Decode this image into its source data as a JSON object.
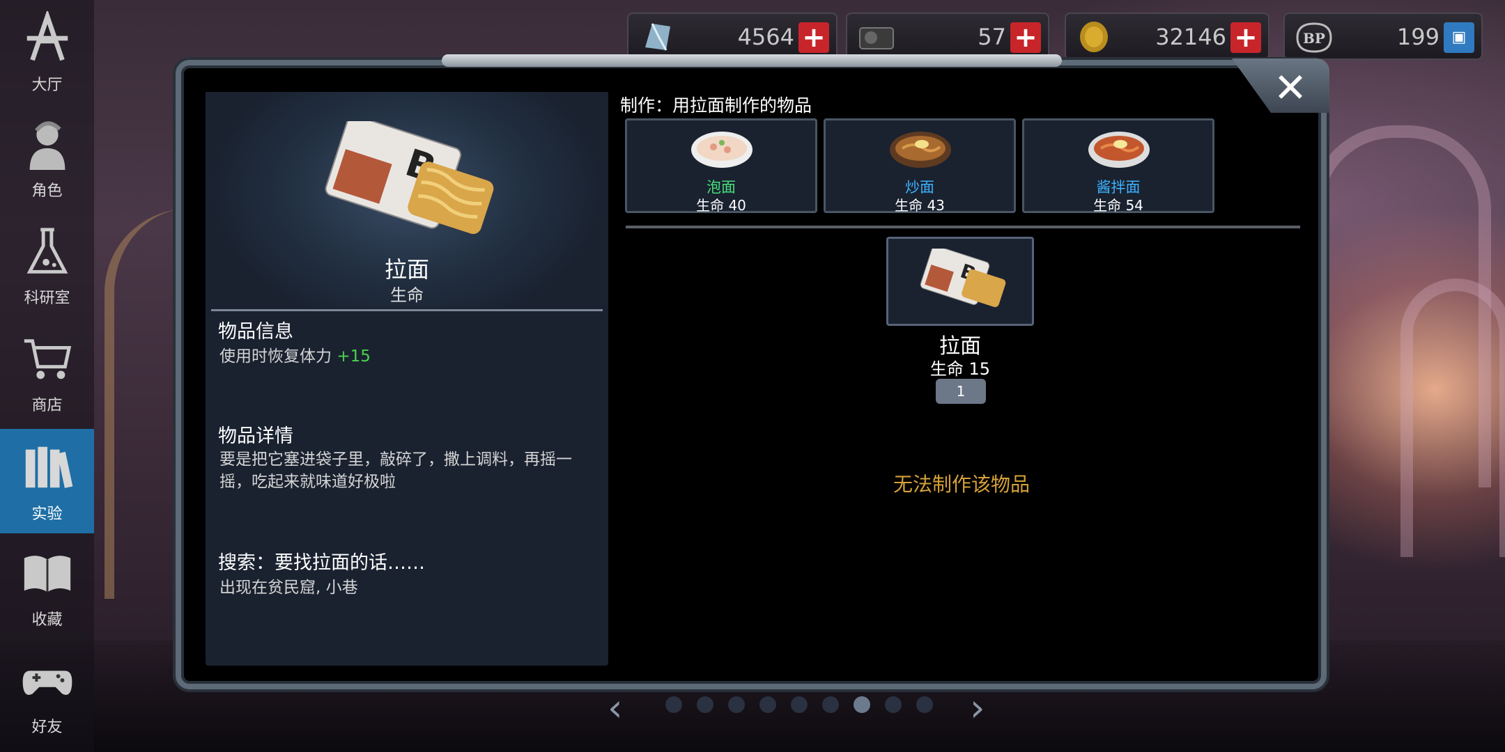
{
  "nav": {
    "items": [
      {
        "label": "大厅",
        "icon": "star-logo-icon"
      },
      {
        "label": "角色",
        "icon": "character-icon"
      },
      {
        "label": "科研室",
        "icon": "flask-icon"
      },
      {
        "label": "商店",
        "icon": "cart-icon"
      },
      {
        "label": "实验",
        "icon": "books-icon",
        "active": true
      },
      {
        "label": "收藏",
        "icon": "book-open-icon"
      },
      {
        "label": "好友",
        "icon": "gamepad-icon"
      }
    ]
  },
  "currencies": [
    {
      "name": "crystal",
      "value": "4564",
      "icon": "crystal-icon"
    },
    {
      "name": "disk",
      "value": "57",
      "icon": "disk-icon"
    },
    {
      "name": "coin",
      "value": "32146",
      "icon": "coin-icon"
    },
    {
      "name": "bp",
      "value": "199",
      "icon": "bp-paw-icon"
    }
  ],
  "item": {
    "name": "拉面",
    "type": "生命",
    "info_title": "物品信息",
    "info_text": "使用时恢复体力",
    "info_bonus": "+15",
    "detail_title": "物品详情",
    "detail_text": "要是把它塞进袋子里，敲碎了，撒上调料，再摇一摇，吃起来就味道好极啦",
    "search_title": "搜索：要找拉面的话……",
    "search_text": "出现在贫民窟, 小巷"
  },
  "crafting": {
    "title": "制作：用拉面制作的物品",
    "recipes": [
      {
        "name": "泡面",
        "stat": "生命 40",
        "color": "#46e07a"
      },
      {
        "name": "炒面",
        "stat": "生命 43",
        "color": "#3cb3ff"
      },
      {
        "name": "酱拌面",
        "stat": "生命 54",
        "color": "#3cb3ff"
      }
    ],
    "ingredient": {
      "name": "拉面",
      "stat": "生命 15",
      "count": "1"
    },
    "status": "无法制作该物品"
  },
  "pager": {
    "total": 9,
    "active": 7
  }
}
